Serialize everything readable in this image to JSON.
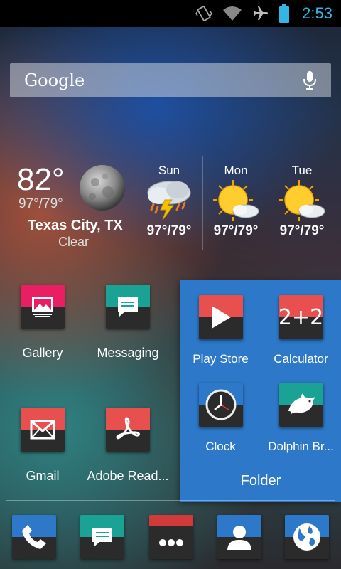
{
  "status_bar": {
    "time": "2:53"
  },
  "search": {
    "logo": "Google"
  },
  "weather": {
    "current_temp": "82°",
    "current_range": "97°/79°",
    "city": "Texas City, TX",
    "condition": "Clear",
    "forecast": [
      {
        "day": "Sun",
        "range": "97°/79°",
        "icon": "thunderstorm-icon"
      },
      {
        "day": "Mon",
        "range": "97°/79°",
        "icon": "sun-cloud-icon"
      },
      {
        "day": "Tue",
        "range": "97°/79°",
        "icon": "sun-cloud-icon"
      }
    ]
  },
  "apps": [
    {
      "label": "Gallery",
      "color": "#e91e63"
    },
    {
      "label": "Messaging",
      "color": "#1aa394"
    },
    {
      "label": "Gmail",
      "color": "#e8504f"
    },
    {
      "label": "Adobe Read...",
      "color": "#e8504f"
    }
  ],
  "folder": {
    "name": "Folder",
    "items": [
      {
        "label": "Play Store",
        "color": "#e8504f"
      },
      {
        "label": "Calculator",
        "color": "#e8504f",
        "glyph": "2+2"
      },
      {
        "label": "Clock",
        "color": "#2d78c8"
      },
      {
        "label": "Dolphin Br...",
        "color": "#1aa394"
      }
    ]
  },
  "dock": [
    {
      "name": "phone-icon",
      "color": "#2d78c8"
    },
    {
      "name": "messaging-icon",
      "color": "#1aa394"
    },
    {
      "name": "app-drawer-icon",
      "color": "#d23a3a"
    },
    {
      "name": "contacts-icon",
      "color": "#2d78c8"
    },
    {
      "name": "browser-icon",
      "color": "#2d78c8"
    }
  ]
}
